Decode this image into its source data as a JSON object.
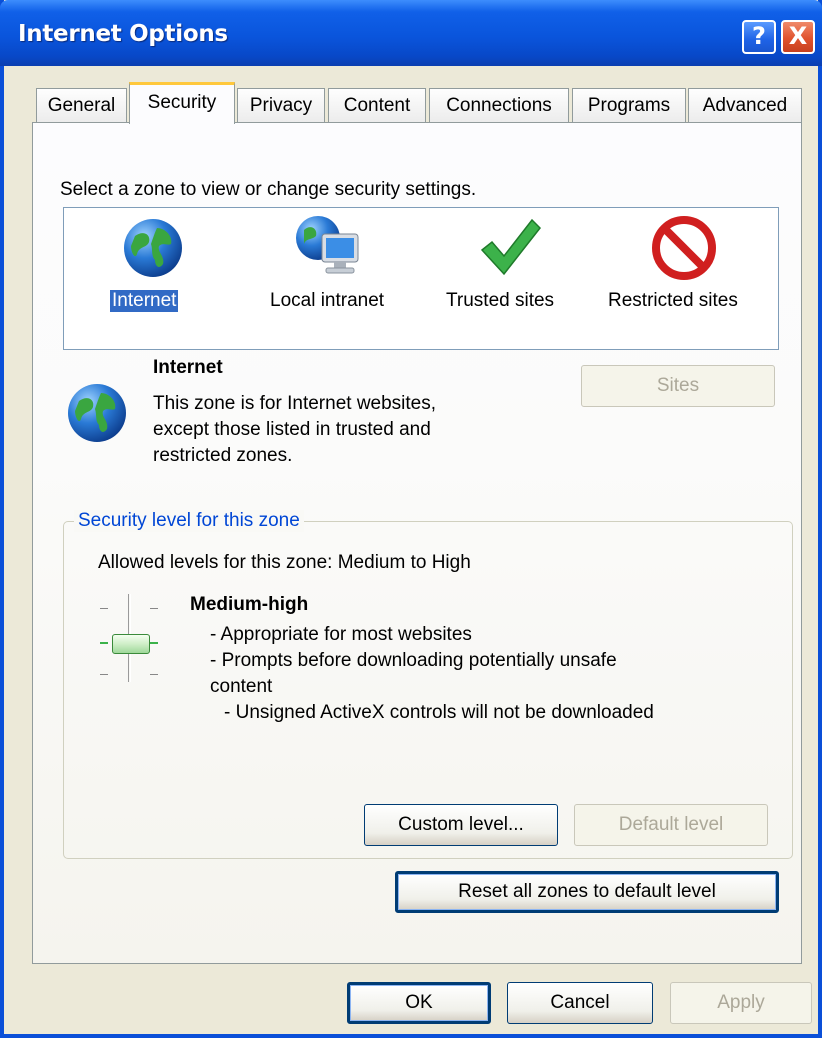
{
  "window": {
    "title": "Internet Options"
  },
  "titlebar_buttons": {
    "help": "?",
    "close": "X"
  },
  "tabs": [
    {
      "label": "General"
    },
    {
      "label": "Security"
    },
    {
      "label": "Privacy"
    },
    {
      "label": "Content"
    },
    {
      "label": "Connections"
    },
    {
      "label": "Programs"
    },
    {
      "label": "Advanced"
    }
  ],
  "active_tab": "Security",
  "security": {
    "instruction": "Select a zone to view or change security settings.",
    "zones": [
      {
        "label": "Internet",
        "icon": "globe-icon",
        "selected": true
      },
      {
        "label": "Local intranet",
        "icon": "intranet-icon",
        "selected": false
      },
      {
        "label": "Trusted sites",
        "icon": "checkmark-icon",
        "selected": false
      },
      {
        "label": "Restricted sites",
        "icon": "restricted-icon",
        "selected": false
      }
    ],
    "selected_zone": {
      "name": "Internet",
      "description_lines": [
        "This zone is for Internet websites,",
        "except those listed in trusted and",
        "restricted zones."
      ],
      "sites_button": "Sites"
    },
    "level_group": {
      "legend": "Security level for this zone",
      "allowed": "Allowed levels for this zone: Medium to High",
      "level_name": "Medium-high",
      "bullets": [
        "- Appropriate for most websites",
        "- Prompts before downloading potentially unsafe",
        "content",
        "- Unsigned ActiveX controls will not be downloaded"
      ],
      "custom_button": "Custom level...",
      "default_button": "Default level"
    },
    "reset_button": "Reset all zones to default level"
  },
  "footer": {
    "ok": "OK",
    "cancel": "Cancel",
    "apply": "Apply"
  },
  "colors": {
    "title_blue": "#0a55dc",
    "accent_tab": "#ffc83c",
    "selection": "#316ac5",
    "group_legend": "#0046d5"
  }
}
